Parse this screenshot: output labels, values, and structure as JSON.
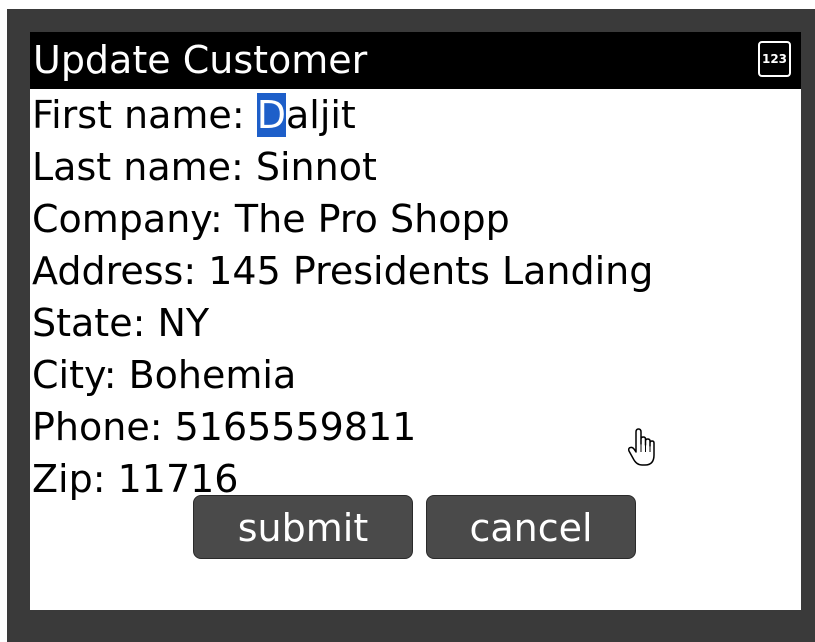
{
  "title": "Update Customer",
  "input_mode_indicator": "123",
  "fields": {
    "first_name": {
      "label": "First name: ",
      "cursor_char": "D",
      "value_rest": "aljit"
    },
    "last_name": {
      "text": "Last name: Sinnot"
    },
    "company": {
      "text": "Company: The Pro Shopp"
    },
    "address": {
      "text": "Address: 145 Presidents Landing"
    },
    "state": {
      "text": "State: NY"
    },
    "city": {
      "text": "City: Bohemia"
    },
    "phone": {
      "text": "Phone: 5165559811"
    },
    "zip": {
      "text": "Zip: 11716"
    }
  },
  "buttons": {
    "submit": "submit",
    "cancel": "cancel"
  },
  "colors": {
    "frame": "#3a3a3a",
    "title_bar": "#000000",
    "cursor_highlight": "#1e5fc9",
    "button": "#4a4a4a"
  },
  "cursor_icon": "hand-pointer-icon"
}
